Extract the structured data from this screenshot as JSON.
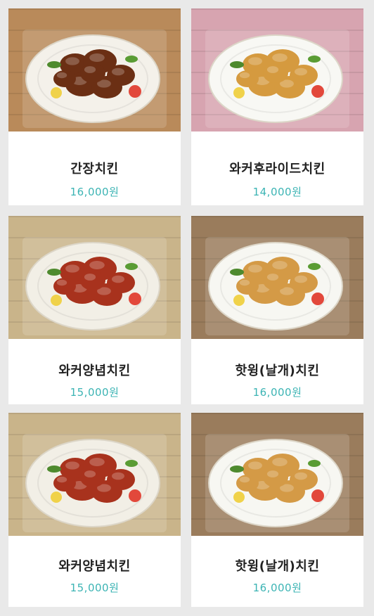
{
  "menu": {
    "items": [
      {
        "name": "간장치킨",
        "price": "16,000원",
        "photo": "soy-chicken-photo",
        "plate_color": "#f4f1ea",
        "food_color": "#6b2f14",
        "bg_color": "#b98a5a"
      },
      {
        "name": "와커후라이드치킨",
        "price": "14,000원",
        "photo": "fried-chicken-photo",
        "plate_color": "#f8f8f4",
        "food_color": "#d59a3f",
        "bg_color": "#d7a4b0"
      },
      {
        "name": "와커양념치킨",
        "price": "15,000원",
        "photo": "seasoned-chicken-photo",
        "plate_color": "#f2efe6",
        "food_color": "#a8321d",
        "bg_color": "#c9b48a"
      },
      {
        "name": "핫윙(날개)치킨",
        "price": "16,000원",
        "photo": "hot-wing-photo",
        "plate_color": "#f7f7f2",
        "food_color": "#d49a46",
        "bg_color": "#9a7c5c"
      },
      {
        "name": "와커양념치킨",
        "price": "15,000원",
        "photo": "seasoned-chicken-photo",
        "plate_color": "#f2efe6",
        "food_color": "#a8321d",
        "bg_color": "#c9b48a"
      },
      {
        "name": "핫윙(날개)치킨",
        "price": "16,000원",
        "photo": "hot-wing-photo",
        "plate_color": "#f7f7f2",
        "food_color": "#d49a46",
        "bg_color": "#9a7c5c"
      }
    ]
  },
  "colors": {
    "price": "#3cb4b4",
    "page_bg": "#e9e9e9",
    "card_bg": "#ffffff"
  }
}
